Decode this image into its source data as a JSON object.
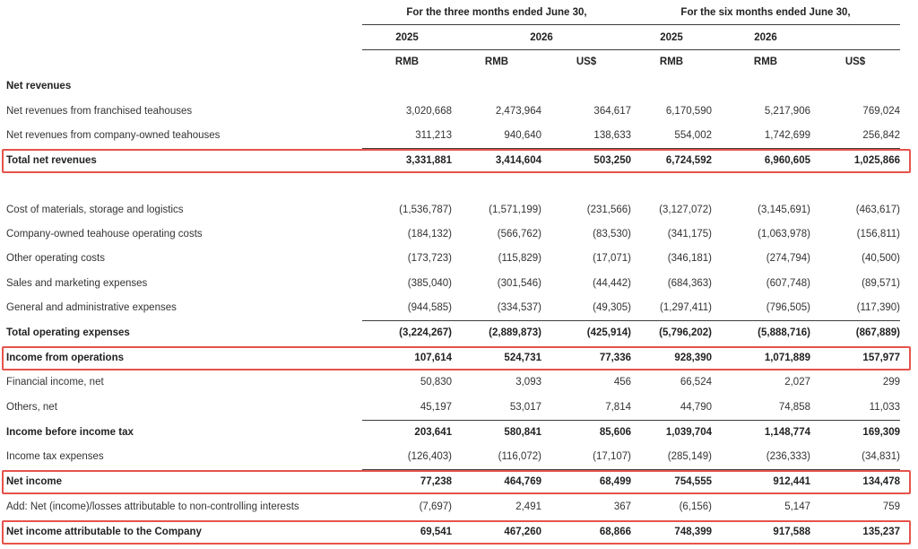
{
  "header": {
    "period_3m": "For the three months ended June 30,",
    "period_6m": "For the six months ended June 30,",
    "years": [
      "2025",
      "2026",
      "2025",
      "2026"
    ],
    "currencies": [
      "RMB",
      "RMB",
      "US$",
      "RMB",
      "RMB",
      "US$"
    ]
  },
  "rows": [
    {
      "label": "Net revenues",
      "bold": true,
      "section": true,
      "values": []
    },
    {
      "label": "Net revenues from franchised teahouses",
      "values": [
        "3,020,668",
        "2,473,964",
        "364,617",
        "6,170,590",
        "5,217,906",
        "769,024"
      ]
    },
    {
      "label": "Net revenues from company-owned teahouses",
      "values": [
        "311,213",
        "940,640",
        "138,633",
        "554,002",
        "1,742,699",
        "256,842"
      ]
    },
    {
      "label": "Total net revenues",
      "bold": true,
      "highlight": true,
      "values": [
        "3,331,881",
        "3,414,604",
        "503,250",
        "6,724,592",
        "6,960,605",
        "1,025,866"
      ]
    },
    {
      "label": "Cost of materials, storage and logistics",
      "values": [
        "(1,536,787)",
        "(1,571,199)",
        "(231,566)",
        "(3,127,072)",
        "(3,145,691)",
        "(463,617)"
      ]
    },
    {
      "label": "Company-owned teahouse operating costs",
      "values": [
        "(184,132)",
        "(566,762)",
        "(83,530)",
        "(341,175)",
        "(1,063,978)",
        "(156,811)"
      ]
    },
    {
      "label": "Other operating costs",
      "values": [
        "(173,723)",
        "(115,829)",
        "(17,071)",
        "(346,181)",
        "(274,794)",
        "(40,500)"
      ]
    },
    {
      "label": "Sales and marketing expenses",
      "values": [
        "(385,040)",
        "(301,546)",
        "(44,442)",
        "(684,363)",
        "(607,748)",
        "(89,571)"
      ]
    },
    {
      "label": "General and administrative expenses",
      "values": [
        "(944,585)",
        "(334,537)",
        "(49,305)",
        "(1,297,411)",
        "(796,505)",
        "(117,390)"
      ]
    },
    {
      "label": "Total operating expenses",
      "bold": true,
      "values": [
        "(3,224,267)",
        "(2,889,873)",
        "(425,914)",
        "(5,796,202)",
        "(5,888,716)",
        "(867,889)"
      ]
    },
    {
      "label": "Income from operations",
      "bold": true,
      "highlight": true,
      "values": [
        "107,614",
        "524,731",
        "77,336",
        "928,390",
        "1,071,889",
        "157,977"
      ]
    },
    {
      "label": "Financial income, net",
      "values": [
        "50,830",
        "3,093",
        "456",
        "66,524",
        "2,027",
        "299"
      ]
    },
    {
      "label": "Others, net",
      "values": [
        "45,197",
        "53,017",
        "7,814",
        "44,790",
        "74,858",
        "11,033"
      ]
    },
    {
      "label": "Income before income tax",
      "bold": true,
      "values": [
        "203,641",
        "580,841",
        "85,606",
        "1,039,704",
        "1,148,774",
        "169,309"
      ]
    },
    {
      "label": "Income tax expenses",
      "values": [
        "(126,403)",
        "(116,072)",
        "(17,107)",
        "(285,149)",
        "(236,333)",
        "(34,831)"
      ]
    },
    {
      "label": "Net income",
      "bold": true,
      "highlight": true,
      "values": [
        "77,238",
        "464,769",
        "68,499",
        "754,555",
        "912,441",
        "134,478"
      ]
    },
    {
      "label": "Add: Net (income)/losses attributable to non-controlling interests",
      "values": [
        "(7,697)",
        "2,491",
        "367",
        "(6,156)",
        "5,147",
        "759"
      ]
    },
    {
      "label": "Net income attributable to the Company",
      "bold": true,
      "highlight": true,
      "values": [
        "69,541",
        "467,260",
        "68,866",
        "748,399",
        "917,588",
        "135,237"
      ]
    }
  ]
}
